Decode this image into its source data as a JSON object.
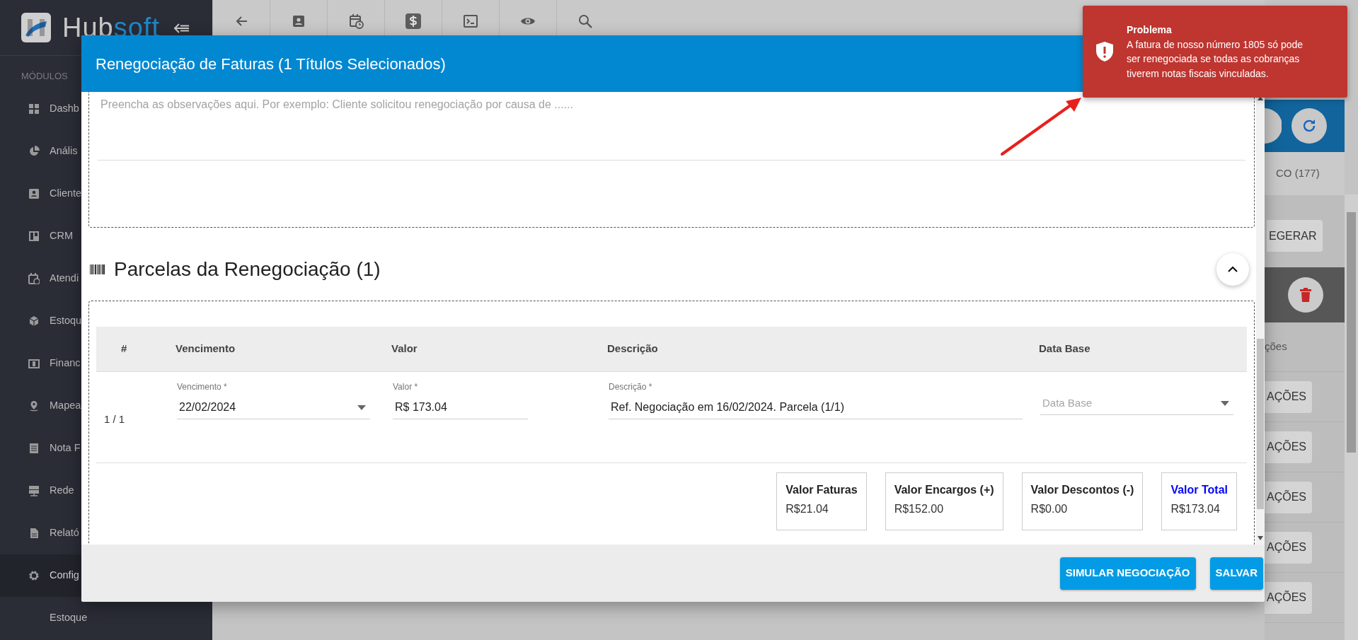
{
  "sidebar": {
    "logo": {
      "part_1": "Hub",
      "part_2": "soft"
    },
    "section_title": "MÓDULOS",
    "items": [
      {
        "label": "Dashb",
        "kind": "module",
        "selected": false
      },
      {
        "label": "Anális",
        "kind": "module",
        "selected": false
      },
      {
        "label": "Cliente",
        "kind": "module",
        "selected": false
      },
      {
        "label": "CRM",
        "kind": "module",
        "selected": false
      },
      {
        "label": "Atendi",
        "kind": "module",
        "selected": false
      },
      {
        "label": "Estoqu",
        "kind": "module",
        "selected": false
      },
      {
        "label": "Financ",
        "kind": "module",
        "selected": false
      },
      {
        "label": "Mapea",
        "kind": "module",
        "selected": false
      },
      {
        "label": "Nota F",
        "kind": "module",
        "selected": false
      },
      {
        "label": "Rede",
        "kind": "module",
        "selected": false
      },
      {
        "label": "Relató",
        "kind": "module",
        "selected": false
      },
      {
        "label": "Config",
        "kind": "module",
        "selected": true
      },
      {
        "label": "Estoque",
        "kind": "subitem",
        "selected": false
      }
    ]
  },
  "toolbar": [
    {
      "selected": false
    },
    {
      "selected": false
    },
    {
      "selected": false
    },
    {
      "selected": true
    },
    {
      "selected": false
    },
    {
      "selected": false
    },
    {
      "selected": false
    }
  ],
  "background": {
    "tab_label": "CO (177)",
    "regenerate_button": "EGERAR",
    "column_label": "ções",
    "action_buttons": [
      "AÇÕES",
      "AÇÕES",
      "AÇÕES",
      "AÇÕES",
      "AÇÕES"
    ]
  },
  "modal": {
    "title": "Renegociação de Faturas (1 Títulos Selecionados)",
    "observations": {
      "placeholder": "Preencha as observações aqui. Por exemplo: Cliente solicitou renegociação por causa de ......"
    },
    "section_title": "Parcelas da Renegociação (1)",
    "table": {
      "columns": [
        "#",
        "Vencimento",
        "Valor",
        "Descrição",
        "Data Base"
      ],
      "rows": [
        {
          "number": "1 / 1",
          "fields": [
            {
              "kind": "select",
              "label": "Vencimento *",
              "value": "22/02/2024"
            },
            {
              "kind": "text",
              "label": "Valor *",
              "value": "R$ 173.04"
            },
            {
              "kind": "text",
              "label": "Descrição *",
              "value": "Ref. Negociação em 16/02/2024. Parcela (1/1)"
            },
            {
              "kind": "select",
              "placeholder": "Data Base"
            }
          ]
        }
      ]
    },
    "totals": [
      {
        "label": "Valor Faturas",
        "value": "R$21.04",
        "highlight": false
      },
      {
        "label": "Valor Encargos (+)",
        "value": "R$152.00",
        "highlight": false
      },
      {
        "label": "Valor Descontos (-)",
        "value": "R$0.00",
        "highlight": false
      },
      {
        "label": "Valor Total",
        "value": "R$173.04",
        "highlight": true
      }
    ],
    "buttons": [
      "SIMULAR NEGOCIAÇÃO",
      "SALVAR"
    ]
  },
  "toast": {
    "title": "Problema",
    "message": "A fatura de nosso número 1805 só pode ser renegociada se todas as cobranças tiverem notas fiscais vinculadas."
  }
}
